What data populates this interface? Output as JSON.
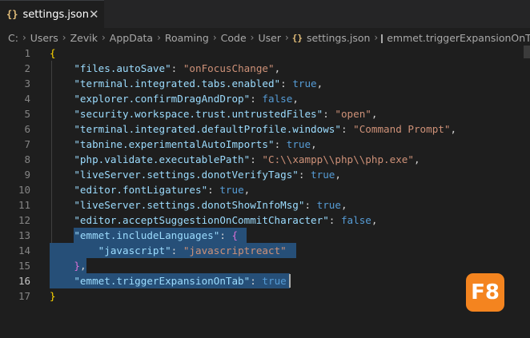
{
  "tab": {
    "icon": "json-braces-icon",
    "icon_text": "{}",
    "filename": "settings.json",
    "close_glyph": "✕"
  },
  "breadcrumb": {
    "items": [
      "C:",
      "Users",
      "Zevik",
      "AppData",
      "Roaming",
      "Code",
      "User"
    ],
    "file": "settings.json",
    "symbol": "emmet.triggerExpansionOnTab",
    "separator": "›"
  },
  "editor": {
    "active_line": 16,
    "lines": [
      {
        "n": "1"
      },
      {
        "n": "2"
      },
      {
        "n": "3"
      },
      {
        "n": "4"
      },
      {
        "n": "5"
      },
      {
        "n": "6"
      },
      {
        "n": "7"
      },
      {
        "n": "8"
      },
      {
        "n": "9"
      },
      {
        "n": "10"
      },
      {
        "n": "11"
      },
      {
        "n": "12"
      },
      {
        "n": "13"
      },
      {
        "n": "14"
      },
      {
        "n": "15"
      },
      {
        "n": "16"
      },
      {
        "n": "17"
      }
    ],
    "tokens": {
      "open": "{",
      "close": "}",
      "l2k": "\"files.autoSave\"",
      "l2v": "\"onFocusChange\"",
      "l3k": "\"terminal.integrated.tabs.enabled\"",
      "l3v": "true",
      "l4k": "\"explorer.confirmDragAndDrop\"",
      "l4v": "false",
      "l5k": "\"security.workspace.trust.untrustedFiles\"",
      "l5v": "\"open\"",
      "l6k": "\"terminal.integrated.defaultProfile.windows\"",
      "l6v": "\"Command Prompt\"",
      "l7k": "\"tabnine.experimentalAutoImports\"",
      "l7v": "true",
      "l8k": "\"php.validate.executablePath\"",
      "l8v": "\"C:\\\\xampp\\\\php\\\\php.exe\"",
      "l9k": "\"liveServer.settings.donotVerifyTags\"",
      "l9v": "true",
      "l10k": "\"editor.fontLigatures\"",
      "l10v": "true",
      "l11k": "\"liveServer.settings.donotShowInfoMsg\"",
      "l11v": "true",
      "l12k": "\"editor.acceptSuggestionOnCommitCharacter\"",
      "l12v": "false",
      "l13k": "\"emmet.includeLanguages\"",
      "l14k": "\"javascript\"",
      "l14v": "\"javascriptreact\"",
      "l16k": "\"emmet.triggerExpansionOnTab\"",
      "l16v": "true"
    }
  },
  "overlay": {
    "logo_text": "F8"
  },
  "colors": {
    "background": "#1e1e1e",
    "selection": "#264f78",
    "key": "#9cdcfe",
    "string": "#ce9178",
    "boolean": "#569cd6",
    "logo": "#f4841f"
  }
}
